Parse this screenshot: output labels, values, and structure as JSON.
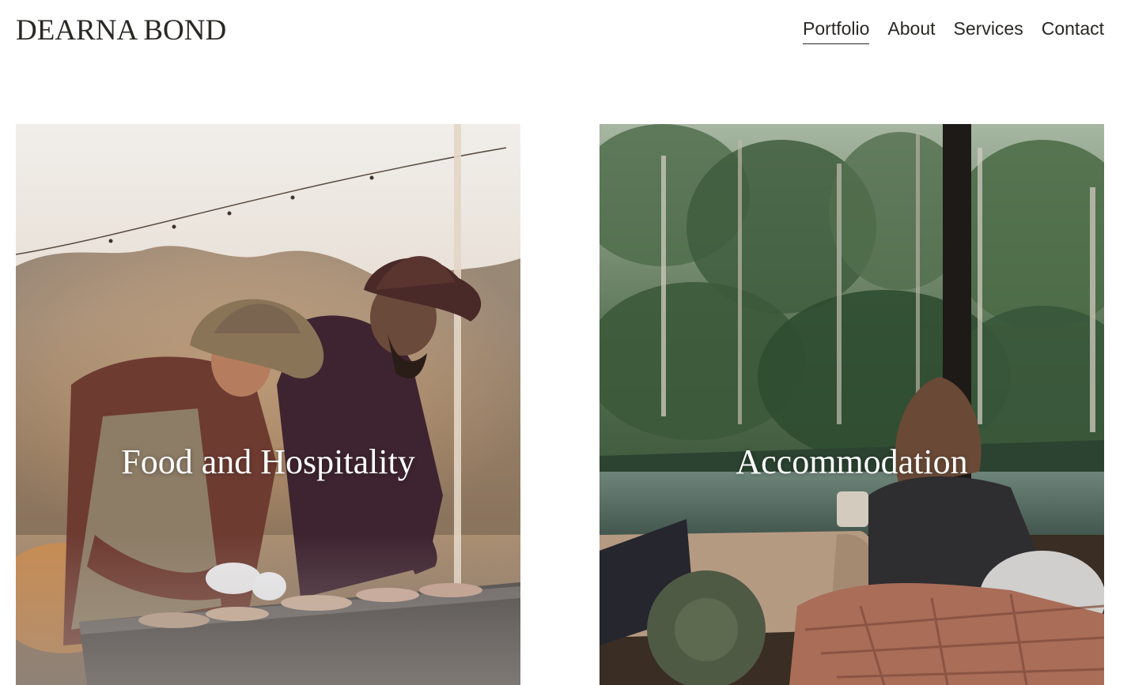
{
  "site": {
    "title": "DEARNA BOND"
  },
  "nav": {
    "items": [
      {
        "label": "Portfolio",
        "active": true
      },
      {
        "label": "About",
        "active": false
      },
      {
        "label": "Services",
        "active": false
      },
      {
        "label": "Contact",
        "active": false
      }
    ]
  },
  "portfolio": {
    "cards": [
      {
        "title": "Food and Hospitality"
      },
      {
        "title": "Accommodation"
      }
    ]
  },
  "colors": {
    "text": "#2a2825",
    "background": "#ffffff",
    "overlay_text": "#ffffff"
  }
}
